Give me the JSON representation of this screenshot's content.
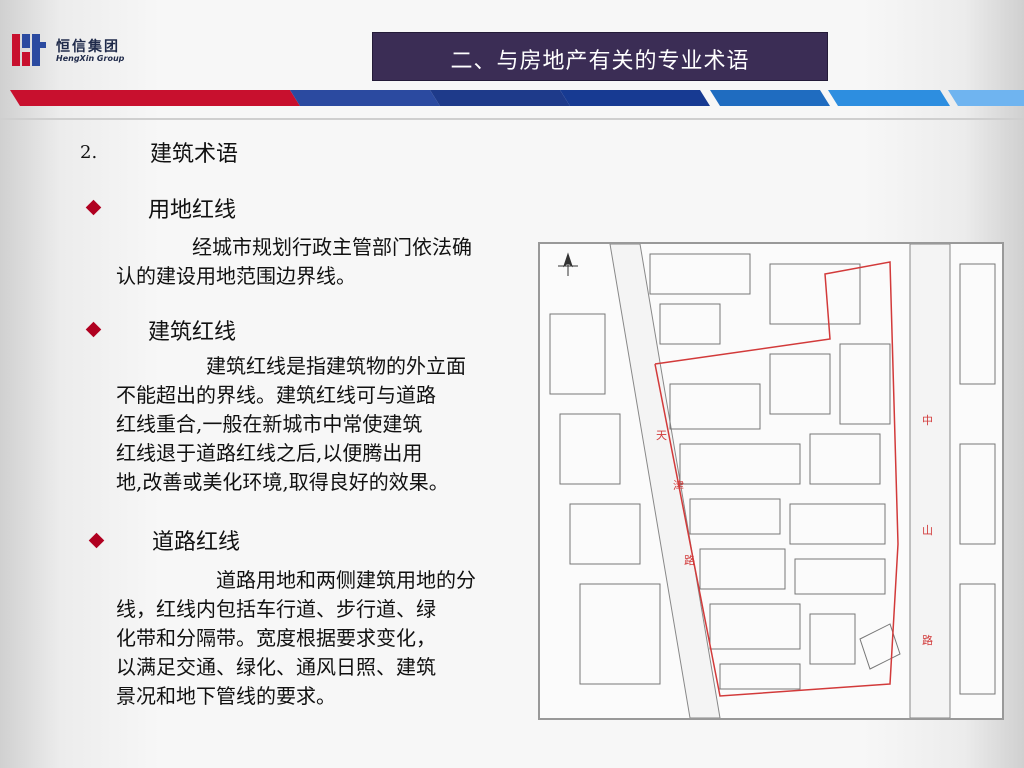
{
  "logo": {
    "name": "恒信集团",
    "sub": "HengXin Group"
  },
  "header": {
    "title": "二、与房地产有关的专业术语"
  },
  "section": {
    "number": "2.",
    "title": "建筑术语"
  },
  "items": [
    {
      "heading": "用地红线",
      "lines": [
        "经城市规划行政主管部门依法确",
        "认的建设用地范围边界线。"
      ]
    },
    {
      "heading": "建筑红线",
      "lines": [
        "建筑红线是指建筑物的外立面",
        "不能超出的界线。建筑红线可与道路",
        "红线重合,一般在新城市中常使建筑",
        "红线退于道路红线之后,以便腾出用",
        "地,改善或美化环境,取得良好的效果。"
      ]
    },
    {
      "heading": "道路红线",
      "lines": [
        "道路用地和两侧建筑用地的分",
        "线，红线内包括车行道、步行道、绿",
        "化带和分隔带。宽度根据要求变化，",
        "以满足交通、绿化、通风日照、建筑",
        "景况和地下管线的要求。"
      ]
    }
  ],
  "map": {
    "left_road_label": [
      "天",
      "津",
      "路"
    ],
    "right_road_label": [
      "中",
      "山",
      "路"
    ]
  },
  "colors": {
    "accent": "#b00020",
    "title_bg": "#3b2d55",
    "redline": "#d23a3a"
  }
}
